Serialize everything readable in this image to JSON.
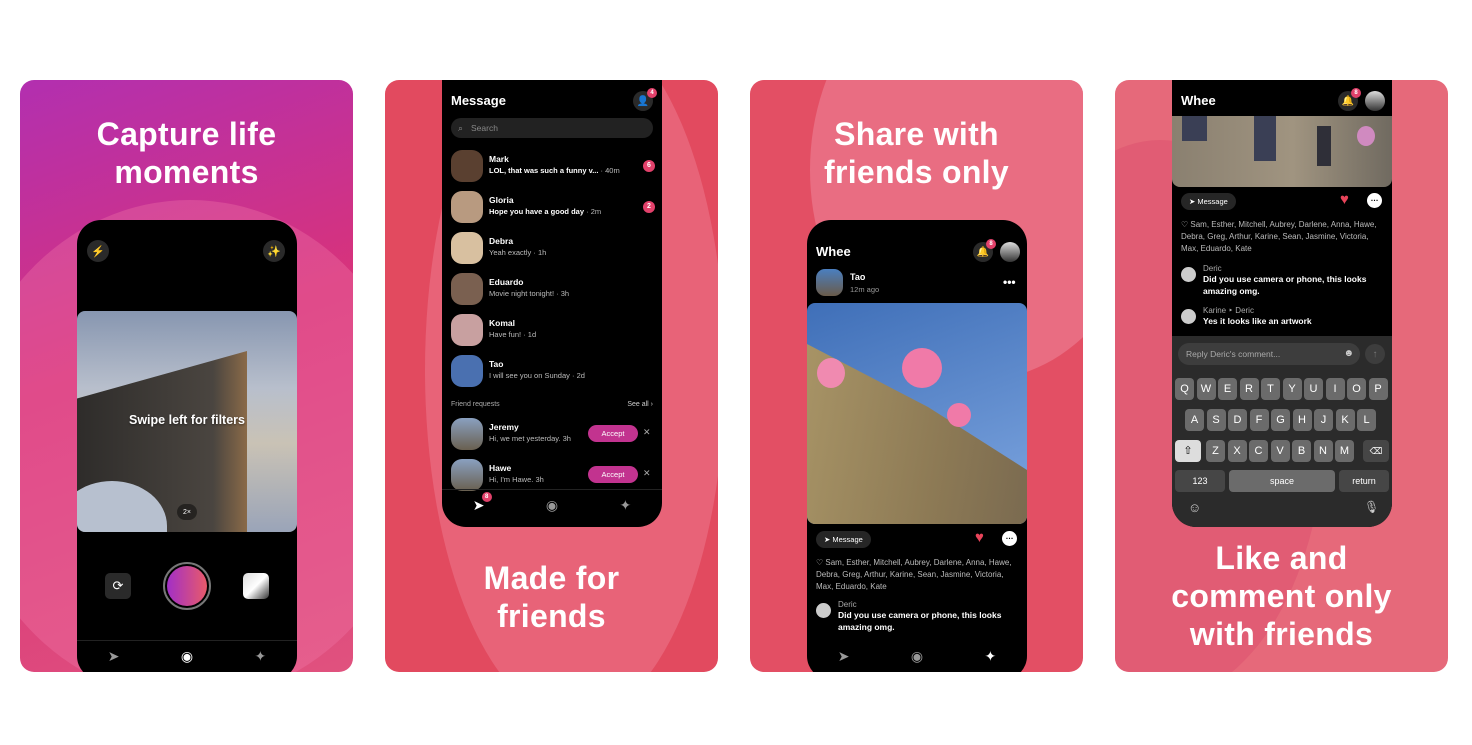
{
  "panels": [
    {
      "headline": [
        "Capture life",
        "moments"
      ],
      "camera": {
        "hint": "Swipe left for filters",
        "zoom": "2×",
        "icons": [
          "flash-off-icon",
          "magic-wand-icon",
          "flip-camera-icon",
          "shutter-button",
          "gallery-thumbnail"
        ]
      },
      "tabs": [
        "send-icon",
        "camera-icon",
        "sparkle-icon"
      ]
    },
    {
      "headline": [
        "Made for",
        "friends"
      ],
      "title": "Message",
      "add_friend_badge": "4",
      "search_placeholder": "Search",
      "conversations": [
        {
          "name": "Mark",
          "message": "LOL, that was such a funny v...",
          "time": "40m",
          "unread": "6",
          "bold": true
        },
        {
          "name": "Gloria",
          "message": "Hope you have a good day",
          "time": "2m",
          "unread": "2",
          "bold": true
        },
        {
          "name": "Debra",
          "message": "Yeah exactly",
          "time": "1h"
        },
        {
          "name": "Eduardo",
          "message": "Movie night tonight!",
          "time": "3h"
        },
        {
          "name": "Komal",
          "message": "Have fun!",
          "time": "1d"
        },
        {
          "name": "Tao",
          "message": "I will see you on Sunday",
          "time": "2d"
        }
      ],
      "friend_requests_label": "Friend requests",
      "see_all": "See all ›",
      "requests": [
        {
          "name": "Jeremy",
          "message": "Hi, we met yesterday. 3h",
          "accept": "Accept"
        },
        {
          "name": "Hawe",
          "message": "Hi, I'm Hawe. 3h",
          "accept": "Accept"
        }
      ],
      "tab_badge": "8"
    },
    {
      "headline": [
        "Share with",
        "friends only"
      ],
      "title": "Whee",
      "notif_badge": "8",
      "post_author": "Tao",
      "post_time": "12m ago",
      "message_button": "Message",
      "likes": "♡ Sam, Esther, Mitchell, Aubrey, Darlene, Anna, Hawe, Debra, Greg, Arthur, Karine, Sean, Jasmine, Victoria, Max, Eduardo, Kate",
      "comment": {
        "name": "Deric",
        "text": "Did you use camera or phone, this looks amazing omg."
      }
    },
    {
      "headline": [
        "Like and",
        "comment only",
        "with friends"
      ],
      "title": "Whee",
      "notif_badge": "8",
      "message_button": "Message",
      "likes": "♡ Sam, Esther, Mitchell, Aubrey, Darlene, Anna, Hawe, Debra, Greg, Arthur, Karine, Sean, Jasmine, Victoria, Max, Eduardo, Kate",
      "comments": [
        {
          "name": "Deric",
          "text": "Did you use camera or phone, this looks amazing omg."
        },
        {
          "name": "Karine ‣ Deric",
          "text": "Yes it looks like an artwork"
        }
      ],
      "reply_placeholder": "Reply Deric's comment...",
      "keyboard": {
        "row1": [
          "Q",
          "W",
          "E",
          "R",
          "T",
          "Y",
          "U",
          "I",
          "O",
          "P"
        ],
        "row2": [
          "A",
          "S",
          "D",
          "F",
          "G",
          "H",
          "J",
          "K",
          "L"
        ],
        "row3": [
          "Z",
          "X",
          "C",
          "V",
          "B",
          "N",
          "M"
        ],
        "numbers": "123",
        "space": "space",
        "return": "return"
      }
    }
  ],
  "colors": {
    "accent": "#c2338f",
    "badge": "#e2416b",
    "heart": "#e8445a"
  }
}
